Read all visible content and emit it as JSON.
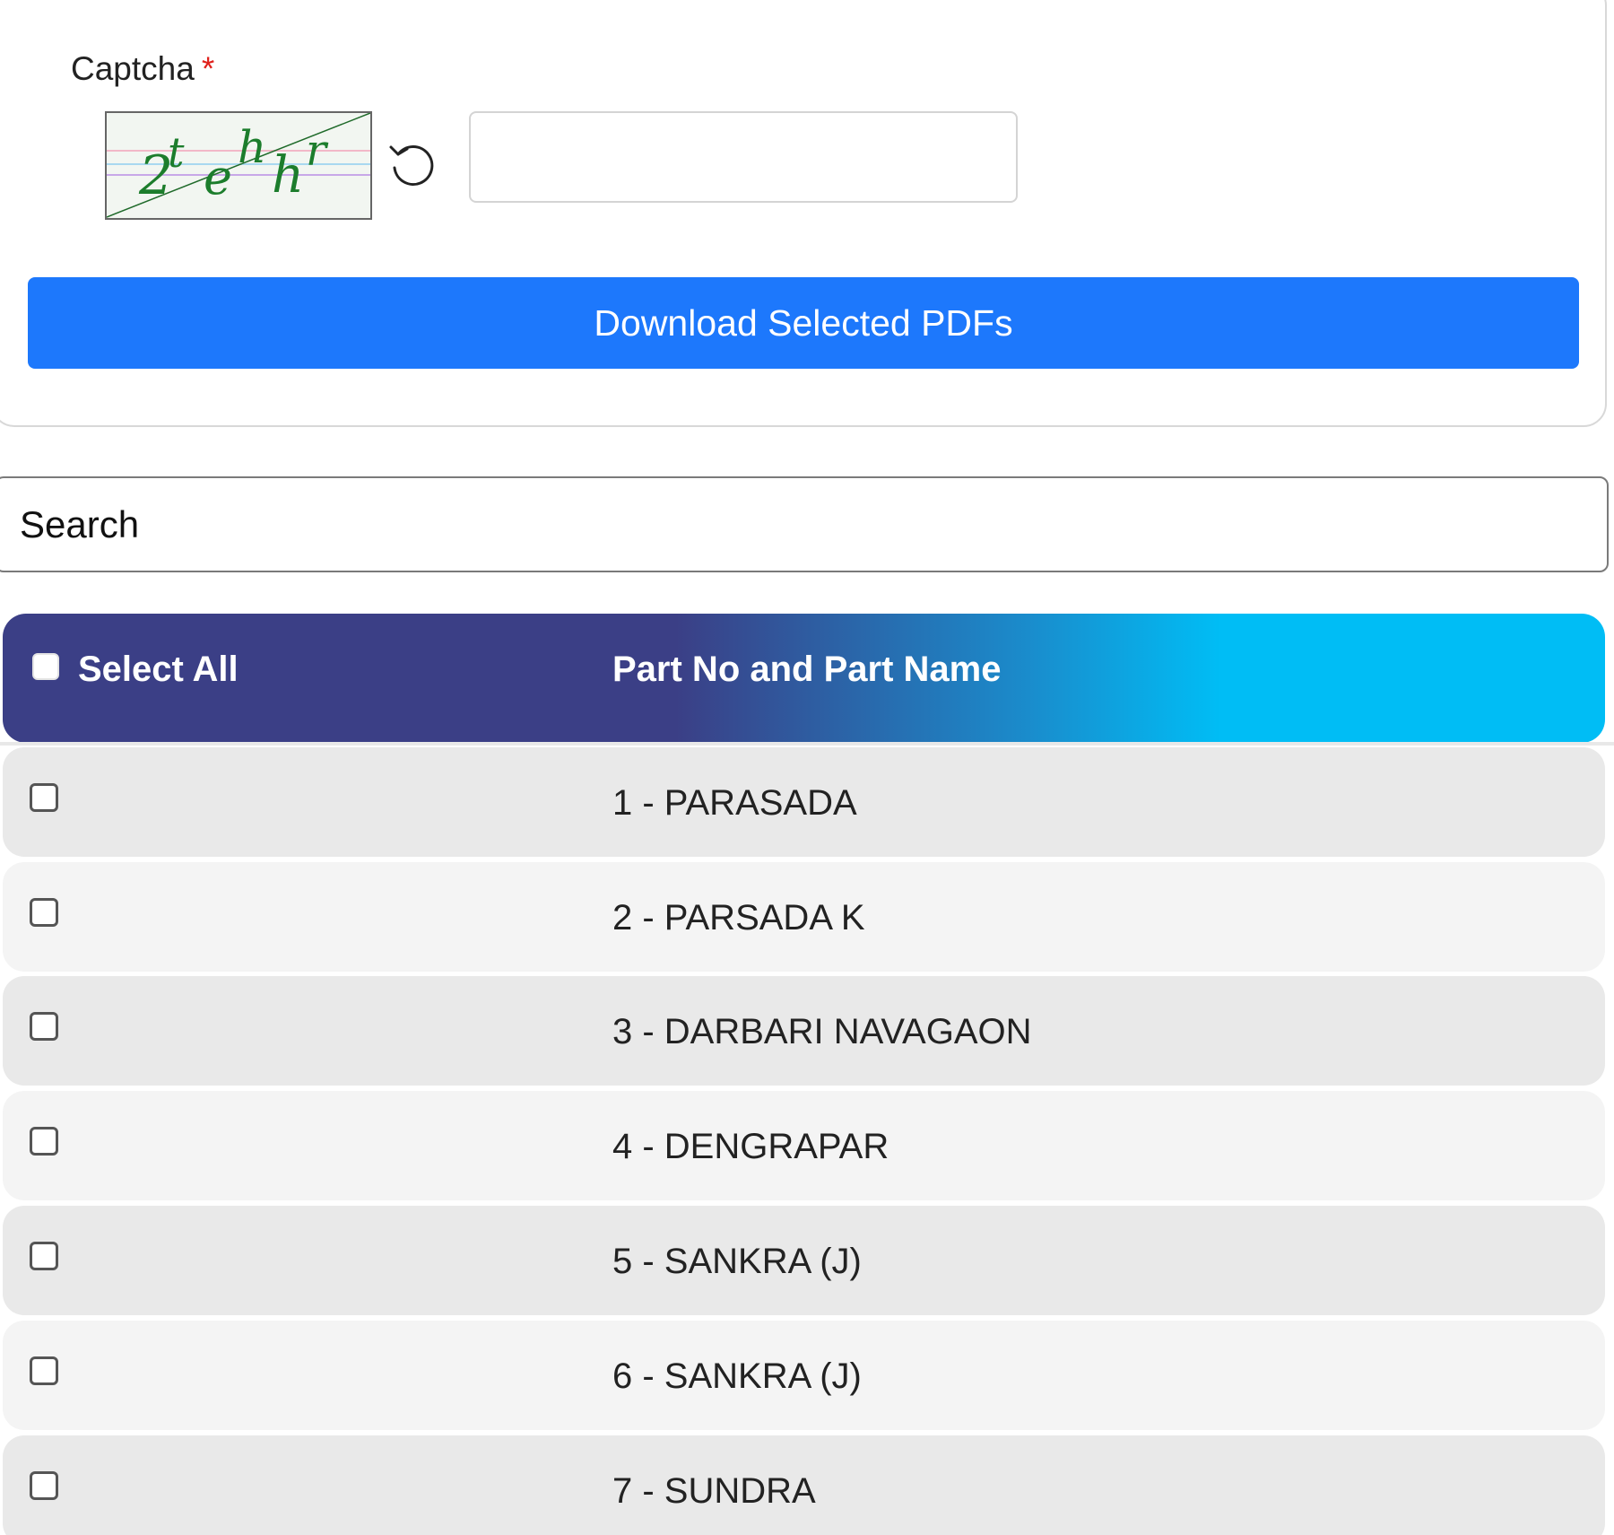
{
  "captcha": {
    "label": "Captcha",
    "required_mark": "*",
    "image_text": "2tehhr",
    "input_value": "",
    "refresh_icon": "refresh-icon"
  },
  "download_button": {
    "label": "Download Selected PDFs",
    "color": "#1d78fc"
  },
  "search": {
    "placeholder": "Search",
    "value": ""
  },
  "table": {
    "header": {
      "select_all_label": "Select All",
      "part_column_label": "Part No and Part Name",
      "gradient_start": "#3b3f86",
      "gradient_end": "#00bdf5"
    },
    "rows": [
      {
        "label": "1 - PARASADA",
        "checked": false
      },
      {
        "label": "2 - PARSADA K",
        "checked": false
      },
      {
        "label": "3 - DARBARI NAVAGAON",
        "checked": false
      },
      {
        "label": "4 - DENGRAPAR",
        "checked": false
      },
      {
        "label": "5 - SANKRA (J)",
        "checked": false
      },
      {
        "label": "6 - SANKRA (J)",
        "checked": false
      },
      {
        "label": "7 - SUNDRA",
        "checked": false
      }
    ]
  }
}
